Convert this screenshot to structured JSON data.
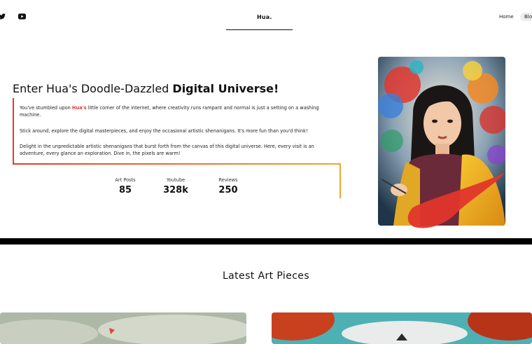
{
  "header": {
    "brand": "Hua.",
    "nav": {
      "home": "Home",
      "blog": "Blo"
    },
    "social": [
      "twitter-icon",
      "youtube-icon"
    ]
  },
  "hero": {
    "title_prefix": "Enter Hua's Doodle-Dazzled ",
    "title_bold": "Digital Universe!",
    "p1_before": "You've stumbled upon ",
    "p1_highlight": "Hua's",
    "p1_after": " little corner of the internet, where creativity runs rampant and normal is just a setting on a washing machine.",
    "p2": "Stick around, explore the digital masterpieces, and enjoy the occasional artistic shenanigans. It's more fun than you'd think!",
    "p3": "Delight in the unpredictable artistic shenanigans that burst forth from the canvas of this digital universe. Here, every visit is an adventure, every glance an exploration. Dive in, the pixels are warm!",
    "stats": [
      {
        "label": "Art Posts",
        "value": "85"
      },
      {
        "label": "Youtube",
        "value": "328k"
      },
      {
        "label": "Reviews",
        "value": "250"
      }
    ]
  },
  "latest": {
    "title": "Latest Art Pieces"
  },
  "colors": {
    "accent_red": "#e23a31",
    "accent_orange": "#f0a52f",
    "divider": "#000000"
  }
}
